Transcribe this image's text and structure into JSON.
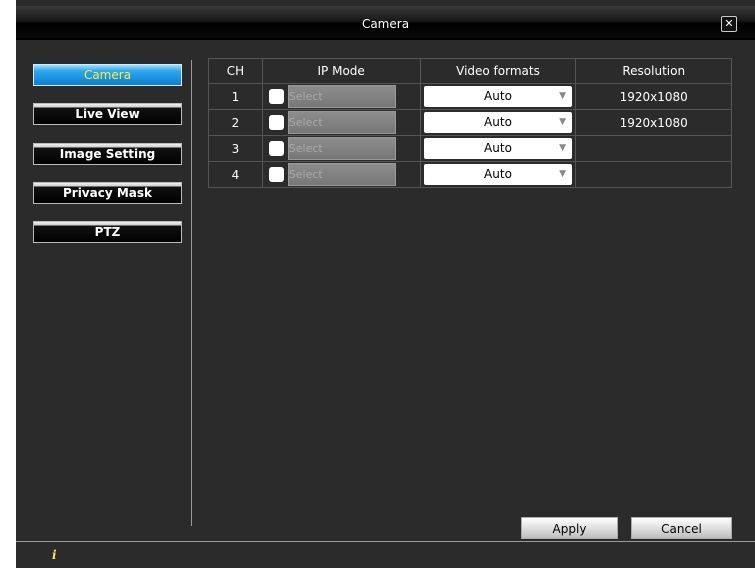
{
  "window": {
    "title": "Camera",
    "close_icon": "✕"
  },
  "sidebar": {
    "items": [
      {
        "label": "Camera",
        "active": true
      },
      {
        "label": "Live View",
        "active": false
      },
      {
        "label": "Image Setting",
        "active": false
      },
      {
        "label": "Privacy Mask",
        "active": false
      },
      {
        "label": "PTZ",
        "active": false
      }
    ]
  },
  "table": {
    "headers": [
      "CH",
      "IP Mode",
      "Video formats",
      "Resolution"
    ],
    "select_label": "Select",
    "rows": [
      {
        "ch": "1",
        "video_format": "Auto",
        "resolution": "1920x1080"
      },
      {
        "ch": "2",
        "video_format": "Auto",
        "resolution": "1920x1080"
      },
      {
        "ch": "3",
        "video_format": "Auto",
        "resolution": ""
      },
      {
        "ch": "4",
        "video_format": "Auto",
        "resolution": ""
      }
    ]
  },
  "footer": {
    "apply_label": "Apply",
    "cancel_label": "Cancel",
    "info_icon": "i"
  },
  "colors": {
    "accent_active": "#0c7ed2",
    "active_text": "#ffef3a",
    "info": "#ffe44d"
  }
}
